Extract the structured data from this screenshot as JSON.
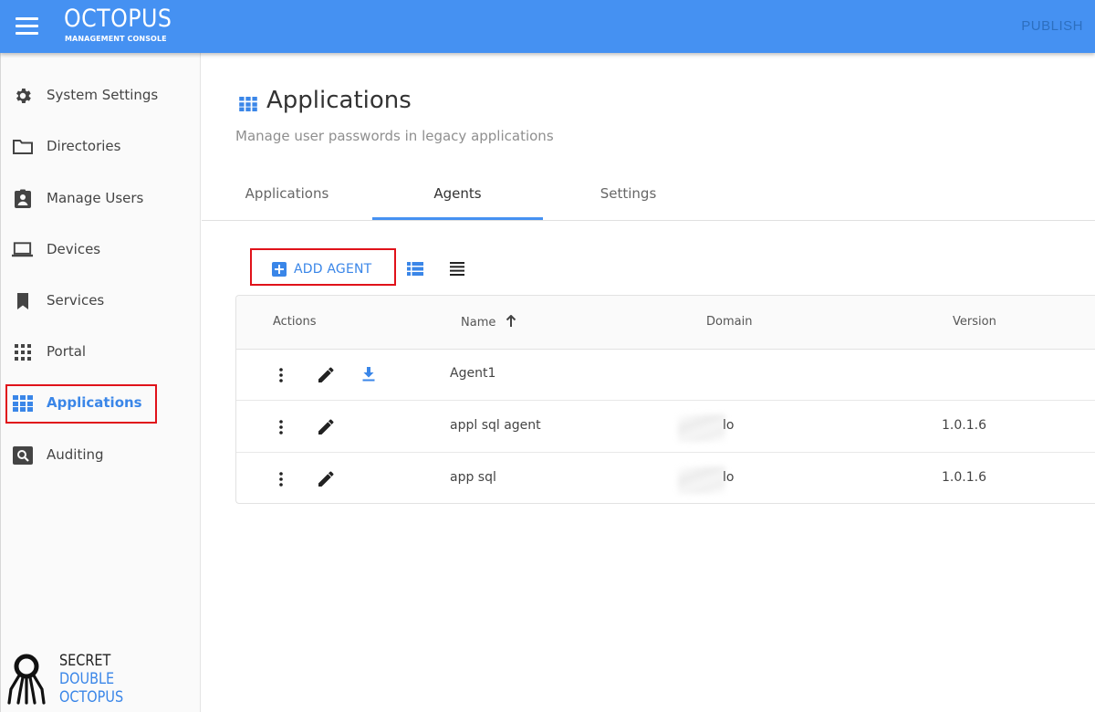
{
  "header": {
    "brand_title": "OCTOPUS",
    "brand_subtitle": "MANAGEMENT CONSOLE",
    "publish_label": "PUBLISH"
  },
  "sidebar": {
    "items": [
      {
        "label": "System Settings",
        "icon": "gear-icon"
      },
      {
        "label": "Directories",
        "icon": "folder-icon"
      },
      {
        "label": "Manage Users",
        "icon": "user-badge-icon"
      },
      {
        "label": "Devices",
        "icon": "laptop-icon"
      },
      {
        "label": "Services",
        "icon": "bookmark-icon"
      },
      {
        "label": "Portal",
        "icon": "grid-dots-icon"
      },
      {
        "label": "Applications",
        "icon": "apps-grid-icon",
        "active": true
      },
      {
        "label": "Auditing",
        "icon": "search-box-icon"
      }
    ],
    "logo": {
      "line1": "SECRET",
      "line2": "DOUBLE",
      "line3": "OCTOPUS"
    }
  },
  "page": {
    "title": "Applications",
    "subtitle": "Manage user passwords in legacy applications"
  },
  "tabs": [
    {
      "label": "Applications"
    },
    {
      "label": "Agents",
      "active": true
    },
    {
      "label": "Settings"
    }
  ],
  "toolbar": {
    "add_agent_label": "ADD AGENT"
  },
  "table": {
    "columns": {
      "actions": "Actions",
      "name": "Name",
      "domain": "Domain",
      "version": "Version"
    },
    "sort": {
      "column": "Name",
      "direction": "ascending"
    },
    "rows": [
      {
        "name": "Agent1",
        "domain": "",
        "version": "",
        "download": true
      },
      {
        "name": "appl sql agent",
        "domain": "lo",
        "version": "1.0.1.6",
        "download": false
      },
      {
        "name": "app sql",
        "domain": "lo",
        "version": "1.0.1.6",
        "download": false
      }
    ]
  },
  "colors": {
    "accent": "#4591f2",
    "active_text": "#3a86e8",
    "highlight_box": "#e0121a"
  }
}
